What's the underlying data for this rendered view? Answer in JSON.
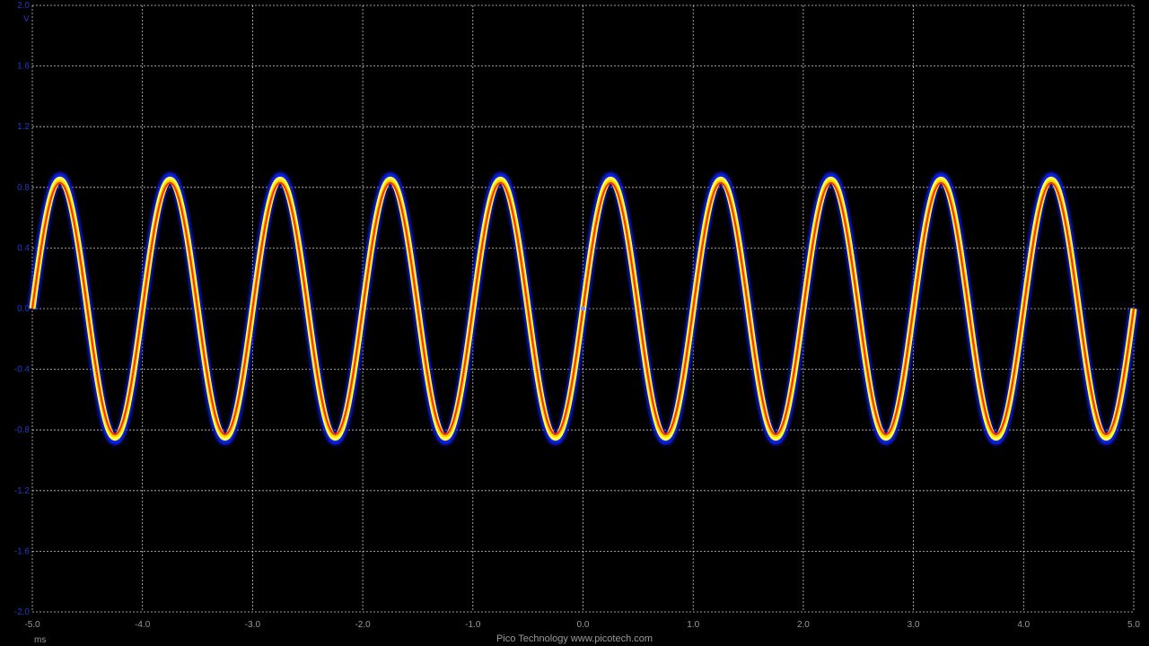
{
  "chart_data": {
    "type": "line",
    "title": "",
    "xlabel": "",
    "ylabel": "",
    "x_unit": "ms",
    "y_unit_marker": "V",
    "xlim": [
      -5.0,
      5.0
    ],
    "ylim": [
      -2.0,
      2.0
    ],
    "x_ticks": [
      "-5.0",
      "-4.0",
      "-3.0",
      "-2.0",
      "-1.0",
      "0.0",
      "1.0",
      "2.0",
      "3.0",
      "4.0",
      "5.0"
    ],
    "y_ticks": [
      "2.0",
      "1.6",
      "1.2",
      "0.8",
      "0.4",
      "0.0",
      "-0.4",
      "-0.8",
      "-1.2",
      "-1.6",
      "-2.0"
    ],
    "grid": true,
    "display_mode": "persistence",
    "series": [
      {
        "amplitude": 0.85,
        "frequency_khz": 1.0,
        "phase_zero_crossing_ms": 0.0,
        "colors": {
          "core": "#ff2a00",
          "mid": "#ffd000",
          "outer": "#ffff40",
          "edge": "#1020ff"
        }
      }
    ],
    "trigger_marker": {
      "x": 0.0,
      "y": 0.0,
      "color": "#7a8cff"
    }
  },
  "colors": {
    "background": "#000000",
    "grid": "#c8c8c8",
    "y_labels": "#2438c8",
    "x_labels": "#9a9a9a"
  },
  "footer": {
    "text": "Pico Technology  www.picotech.com"
  }
}
